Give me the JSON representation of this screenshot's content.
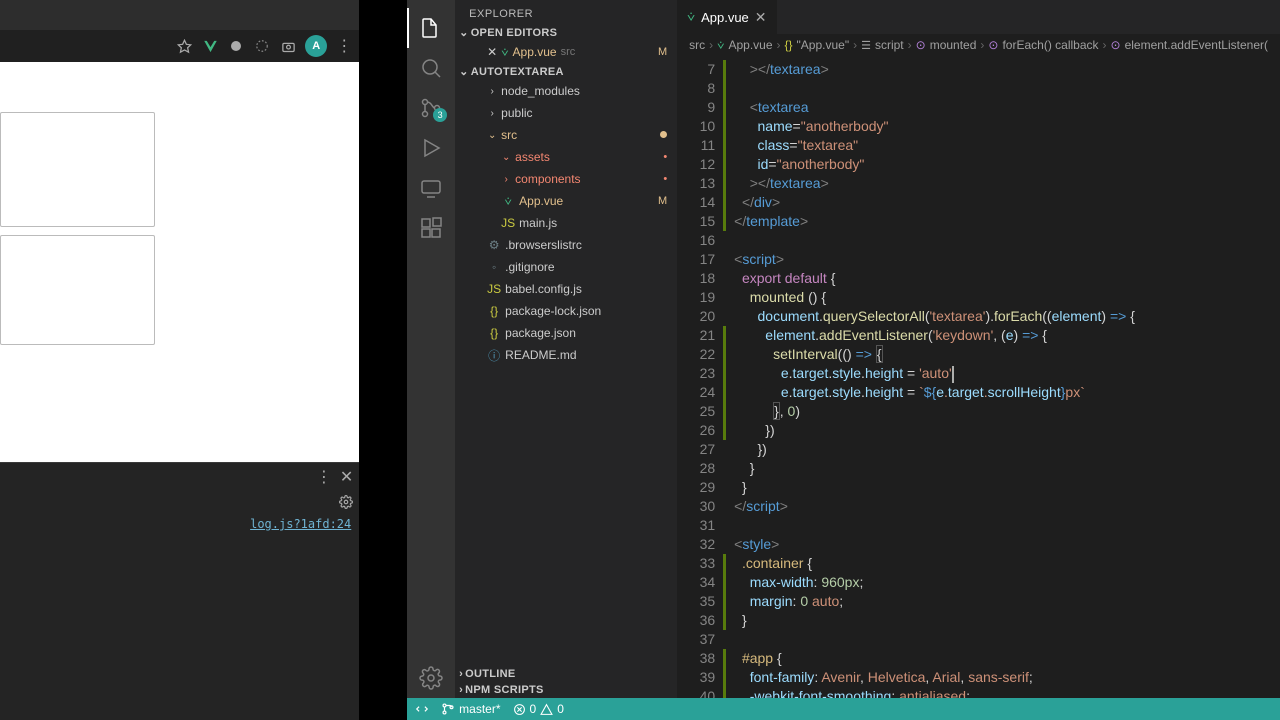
{
  "browser": {
    "avatar_letter": "A",
    "devtools_link": "log.js?1afd:24"
  },
  "vscode": {
    "explorer_label": "EXPLORER",
    "open_editors_label": "OPEN EDITORS",
    "project_label": "AUTOTEXTAREA",
    "outline_label": "OUTLINE",
    "npm_scripts_label": "NPM SCRIPTS",
    "open_editors": [
      {
        "name": "App.vue",
        "folder": "src",
        "status": "M"
      }
    ],
    "tree": {
      "node_modules": "node_modules",
      "public": "public",
      "src": "src",
      "assets": "assets",
      "components": "components",
      "app_vue": "App.vue",
      "app_vue_status": "M",
      "main_js": "main.js",
      "browserslistrc": ".browserslistrc",
      "gitignore": ".gitignore",
      "babel": "babel.config.js",
      "pkg_lock": "package-lock.json",
      "pkg": "package.json",
      "readme": "README.md",
      "src_dot": "●"
    },
    "scm_badge": "3",
    "tab": {
      "name": "App.vue"
    },
    "breadcrumbs": {
      "seg0": "src",
      "seg1": "App.vue",
      "seg2": "\"App.vue\"",
      "seg3": "script",
      "seg4": "mounted",
      "seg5": "forEach() callback",
      "seg6": "element.addEventListener("
    },
    "statusbar": {
      "branch": "master*",
      "errors": "0",
      "warnings": "0"
    },
    "line_start": 7,
    "mod_lines": [
      7,
      8,
      9,
      10,
      11,
      12,
      13,
      14,
      15,
      21,
      22,
      23,
      24,
      25,
      26,
      33,
      34,
      35,
      36,
      38,
      39,
      40
    ]
  }
}
